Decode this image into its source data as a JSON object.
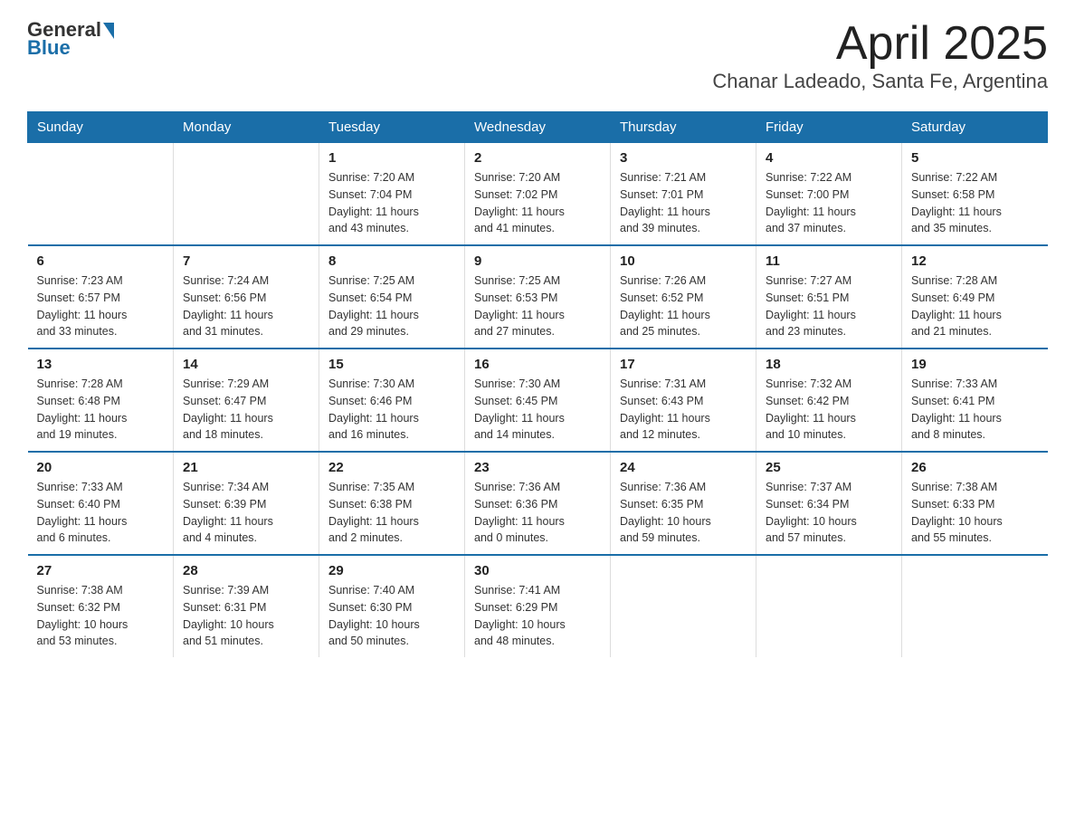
{
  "header": {
    "logo_general": "General",
    "logo_blue": "Blue",
    "title": "April 2025",
    "subtitle": "Chanar Ladeado, Santa Fe, Argentina"
  },
  "days_of_week": [
    "Sunday",
    "Monday",
    "Tuesday",
    "Wednesday",
    "Thursday",
    "Friday",
    "Saturday"
  ],
  "weeks": [
    [
      {
        "num": "",
        "info": ""
      },
      {
        "num": "",
        "info": ""
      },
      {
        "num": "1",
        "info": "Sunrise: 7:20 AM\nSunset: 7:04 PM\nDaylight: 11 hours\nand 43 minutes."
      },
      {
        "num": "2",
        "info": "Sunrise: 7:20 AM\nSunset: 7:02 PM\nDaylight: 11 hours\nand 41 minutes."
      },
      {
        "num": "3",
        "info": "Sunrise: 7:21 AM\nSunset: 7:01 PM\nDaylight: 11 hours\nand 39 minutes."
      },
      {
        "num": "4",
        "info": "Sunrise: 7:22 AM\nSunset: 7:00 PM\nDaylight: 11 hours\nand 37 minutes."
      },
      {
        "num": "5",
        "info": "Sunrise: 7:22 AM\nSunset: 6:58 PM\nDaylight: 11 hours\nand 35 minutes."
      }
    ],
    [
      {
        "num": "6",
        "info": "Sunrise: 7:23 AM\nSunset: 6:57 PM\nDaylight: 11 hours\nand 33 minutes."
      },
      {
        "num": "7",
        "info": "Sunrise: 7:24 AM\nSunset: 6:56 PM\nDaylight: 11 hours\nand 31 minutes."
      },
      {
        "num": "8",
        "info": "Sunrise: 7:25 AM\nSunset: 6:54 PM\nDaylight: 11 hours\nand 29 minutes."
      },
      {
        "num": "9",
        "info": "Sunrise: 7:25 AM\nSunset: 6:53 PM\nDaylight: 11 hours\nand 27 minutes."
      },
      {
        "num": "10",
        "info": "Sunrise: 7:26 AM\nSunset: 6:52 PM\nDaylight: 11 hours\nand 25 minutes."
      },
      {
        "num": "11",
        "info": "Sunrise: 7:27 AM\nSunset: 6:51 PM\nDaylight: 11 hours\nand 23 minutes."
      },
      {
        "num": "12",
        "info": "Sunrise: 7:28 AM\nSunset: 6:49 PM\nDaylight: 11 hours\nand 21 minutes."
      }
    ],
    [
      {
        "num": "13",
        "info": "Sunrise: 7:28 AM\nSunset: 6:48 PM\nDaylight: 11 hours\nand 19 minutes."
      },
      {
        "num": "14",
        "info": "Sunrise: 7:29 AM\nSunset: 6:47 PM\nDaylight: 11 hours\nand 18 minutes."
      },
      {
        "num": "15",
        "info": "Sunrise: 7:30 AM\nSunset: 6:46 PM\nDaylight: 11 hours\nand 16 minutes."
      },
      {
        "num": "16",
        "info": "Sunrise: 7:30 AM\nSunset: 6:45 PM\nDaylight: 11 hours\nand 14 minutes."
      },
      {
        "num": "17",
        "info": "Sunrise: 7:31 AM\nSunset: 6:43 PM\nDaylight: 11 hours\nand 12 minutes."
      },
      {
        "num": "18",
        "info": "Sunrise: 7:32 AM\nSunset: 6:42 PM\nDaylight: 11 hours\nand 10 minutes."
      },
      {
        "num": "19",
        "info": "Sunrise: 7:33 AM\nSunset: 6:41 PM\nDaylight: 11 hours\nand 8 minutes."
      }
    ],
    [
      {
        "num": "20",
        "info": "Sunrise: 7:33 AM\nSunset: 6:40 PM\nDaylight: 11 hours\nand 6 minutes."
      },
      {
        "num": "21",
        "info": "Sunrise: 7:34 AM\nSunset: 6:39 PM\nDaylight: 11 hours\nand 4 minutes."
      },
      {
        "num": "22",
        "info": "Sunrise: 7:35 AM\nSunset: 6:38 PM\nDaylight: 11 hours\nand 2 minutes."
      },
      {
        "num": "23",
        "info": "Sunrise: 7:36 AM\nSunset: 6:36 PM\nDaylight: 11 hours\nand 0 minutes."
      },
      {
        "num": "24",
        "info": "Sunrise: 7:36 AM\nSunset: 6:35 PM\nDaylight: 10 hours\nand 59 minutes."
      },
      {
        "num": "25",
        "info": "Sunrise: 7:37 AM\nSunset: 6:34 PM\nDaylight: 10 hours\nand 57 minutes."
      },
      {
        "num": "26",
        "info": "Sunrise: 7:38 AM\nSunset: 6:33 PM\nDaylight: 10 hours\nand 55 minutes."
      }
    ],
    [
      {
        "num": "27",
        "info": "Sunrise: 7:38 AM\nSunset: 6:32 PM\nDaylight: 10 hours\nand 53 minutes."
      },
      {
        "num": "28",
        "info": "Sunrise: 7:39 AM\nSunset: 6:31 PM\nDaylight: 10 hours\nand 51 minutes."
      },
      {
        "num": "29",
        "info": "Sunrise: 7:40 AM\nSunset: 6:30 PM\nDaylight: 10 hours\nand 50 minutes."
      },
      {
        "num": "30",
        "info": "Sunrise: 7:41 AM\nSunset: 6:29 PM\nDaylight: 10 hours\nand 48 minutes."
      },
      {
        "num": "",
        "info": ""
      },
      {
        "num": "",
        "info": ""
      },
      {
        "num": "",
        "info": ""
      }
    ]
  ],
  "colors": {
    "header_bg": "#1a6ea8",
    "header_text": "#ffffff",
    "border": "#1a6ea8"
  }
}
